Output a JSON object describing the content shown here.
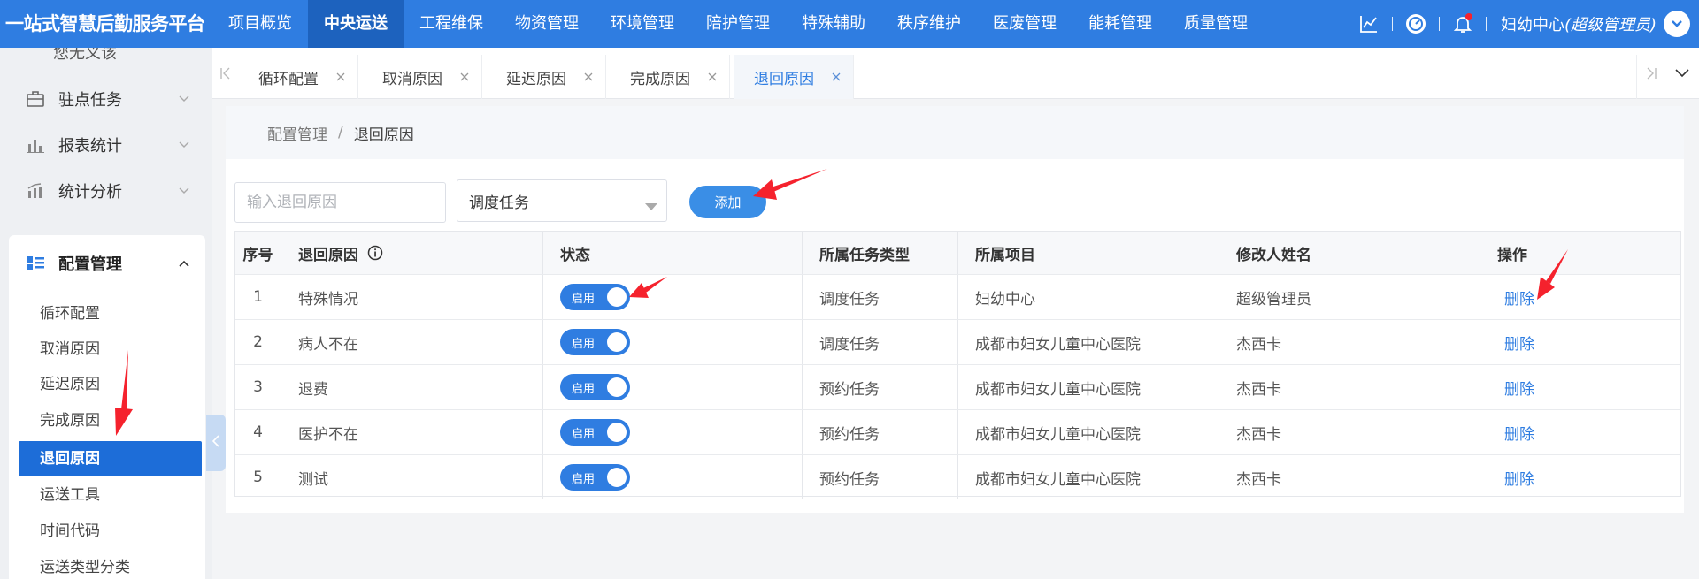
{
  "brand": "一站式智慧后勤服务平台",
  "top_nav": [
    {
      "label": "项目概览"
    },
    {
      "label": "中央运送"
    },
    {
      "label": "工程维保"
    },
    {
      "label": "物资管理"
    },
    {
      "label": "环境管理"
    },
    {
      "label": "陪护管理"
    },
    {
      "label": "特殊辅助"
    },
    {
      "label": "秩序维护"
    },
    {
      "label": "医废管理"
    },
    {
      "label": "能耗管理"
    },
    {
      "label": "质量管理"
    }
  ],
  "top_nav_active": "中央运送",
  "user": {
    "org": "妇幼中心",
    "role": "(超级管理员)"
  },
  "icons": {
    "chart": "line-chart-icon",
    "dashboard": "gauge-icon",
    "notification": "bell-icon",
    "user_menu": "chevron-down-icon"
  },
  "sidebar": {
    "partial_label": "您无义该",
    "items": [
      {
        "label": "驻点任务",
        "icon": "briefcase-icon"
      },
      {
        "label": "报表统计",
        "icon": "bar-chart-icon"
      },
      {
        "label": "统计分析",
        "icon": "analysis-chart-icon"
      },
      {
        "label": "配置管理",
        "icon": "list-grid-icon"
      }
    ],
    "sub_items": [
      {
        "label": "循环配置"
      },
      {
        "label": "取消原因"
      },
      {
        "label": "延迟原因"
      },
      {
        "label": "完成原因"
      },
      {
        "label": "退回原因"
      },
      {
        "label": "运送工具"
      },
      {
        "label": "时间代码"
      },
      {
        "label": "运送类型分类"
      }
    ],
    "active_sub": "退回原因"
  },
  "tabs": [
    {
      "label": "循环配置"
    },
    {
      "label": "取消原因"
    },
    {
      "label": "延迟原因"
    },
    {
      "label": "完成原因"
    },
    {
      "label": "退回原因"
    }
  ],
  "active_tab": "退回原因",
  "breadcrumb": {
    "parent": "配置管理",
    "separator": "/",
    "current": "退回原因"
  },
  "filters": {
    "search_placeholder": "输入退回原因",
    "select_value": "调度任务",
    "add_label": "添加"
  },
  "table": {
    "columns": [
      "序号",
      "退回原因",
      "状态",
      "所属任务类型",
      "所属项目",
      "修改人姓名",
      "操作"
    ],
    "rows": [
      {
        "index": "1",
        "reason": "特殊情况",
        "status": "启用",
        "type": "调度任务",
        "project": "妇幼中心",
        "editor": "超级管理员",
        "action": "删除"
      },
      {
        "index": "2",
        "reason": "病人不在",
        "status": "启用",
        "type": "调度任务",
        "project": "成都市妇女儿童中心医院",
        "editor": "杰西卡",
        "action": "删除"
      },
      {
        "index": "3",
        "reason": "退费",
        "status": "启用",
        "type": "预约任务",
        "project": "成都市妇女儿童中心医院",
        "editor": "杰西卡",
        "action": "删除"
      },
      {
        "index": "4",
        "reason": "医护不在",
        "status": "启用",
        "type": "预约任务",
        "project": "成都市妇女儿童中心医院",
        "editor": "杰西卡",
        "action": "删除"
      },
      {
        "index": "5",
        "reason": "测试",
        "status": "启用",
        "type": "预约任务",
        "project": "成都市妇女儿童中心医院",
        "editor": "杰西卡",
        "action": "删除"
      }
    ]
  },
  "colors": {
    "primary": "#2f7de1",
    "nav_active": "#1d62be",
    "annotation_arrow": "#f5222d"
  }
}
